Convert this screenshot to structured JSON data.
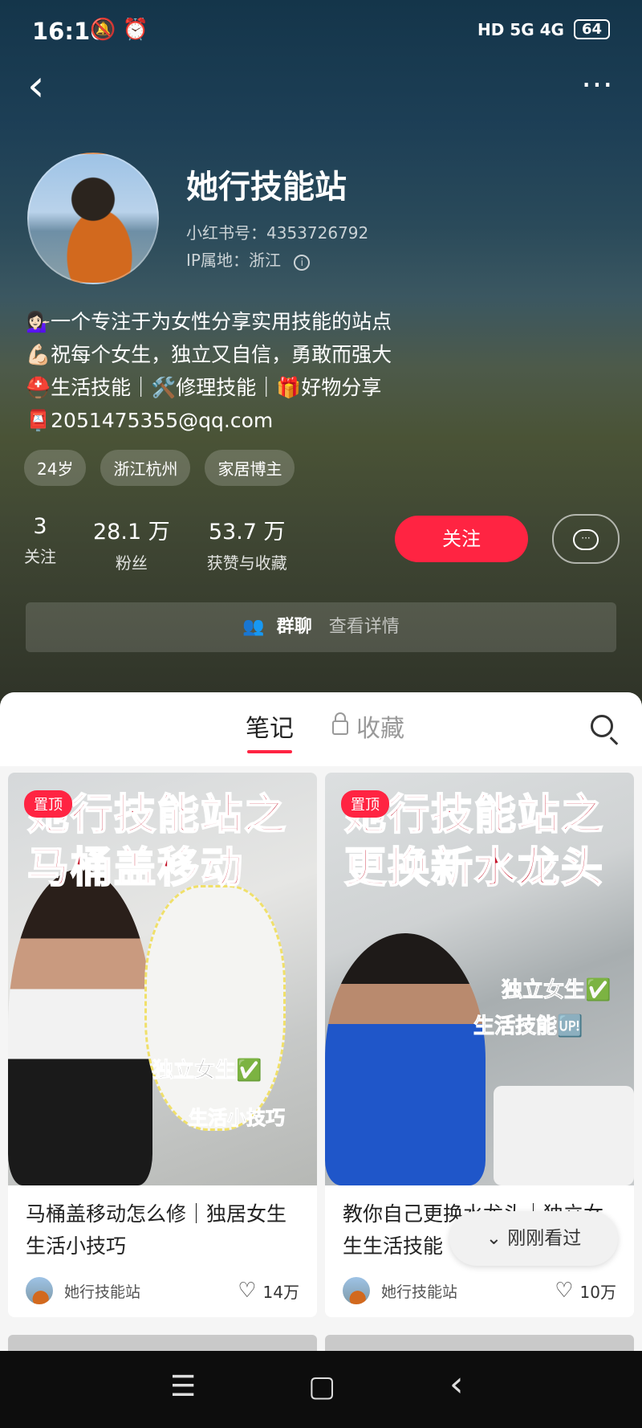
{
  "status_bar": {
    "time": "16:16",
    "icons_left": "🔕 ⏰",
    "network": "HD 5G 4G",
    "battery": "64"
  },
  "header": {
    "back_glyph": "‹",
    "more_glyph": "⋯"
  },
  "profile": {
    "name": "她行技能站",
    "red_id": "小红书号：4353726792",
    "ip_location": "IP属地：浙江",
    "bio": [
      "💁🏻‍♀️一个专注于为女性分享实用技能的站点",
      "💪🏻祝每个女生，独立又自信，勇敢而强大",
      "⛑️生活技能｜🛠️修理技能｜🎁好物分享",
      "📮2051475355@qq.com"
    ],
    "tags": [
      "24岁",
      "浙江杭州",
      "家居博主"
    ],
    "stats": [
      {
        "num": "3",
        "label": "关注"
      },
      {
        "num": "28.1 万",
        "label": "粉丝"
      },
      {
        "num": "53.7 万",
        "label": "获赞与收藏"
      }
    ],
    "follow_label": "关注",
    "group_label": "群聊",
    "group_sub": "查看详情"
  },
  "tabs": {
    "notes": "笔记",
    "collect": "收藏"
  },
  "cards": [
    {
      "pin": "置顶",
      "cover_line1": "她行技能站之",
      "cover_line2": "马桶盖移动",
      "cover_side1": "独立女生✅",
      "cover_side2": "生活小技巧",
      "title": "马桶盖移动怎么修｜独居女生生活小技巧",
      "author": "她行技能站",
      "likes": "14万"
    },
    {
      "pin": "置顶",
      "cover_line1": "她行技能站之",
      "cover_line2": "更换新水龙头",
      "cover_side1": "独立女生✅",
      "cover_side2": "生活技能🆙",
      "title": "教你自己更换水龙头｜独立女生生活技能",
      "author": "她行技能站",
      "likes": "10万"
    }
  ],
  "float_button": "⌄ 刚刚看过",
  "navbar": {
    "menu": "☰",
    "home": "▢",
    "back": "‹"
  }
}
